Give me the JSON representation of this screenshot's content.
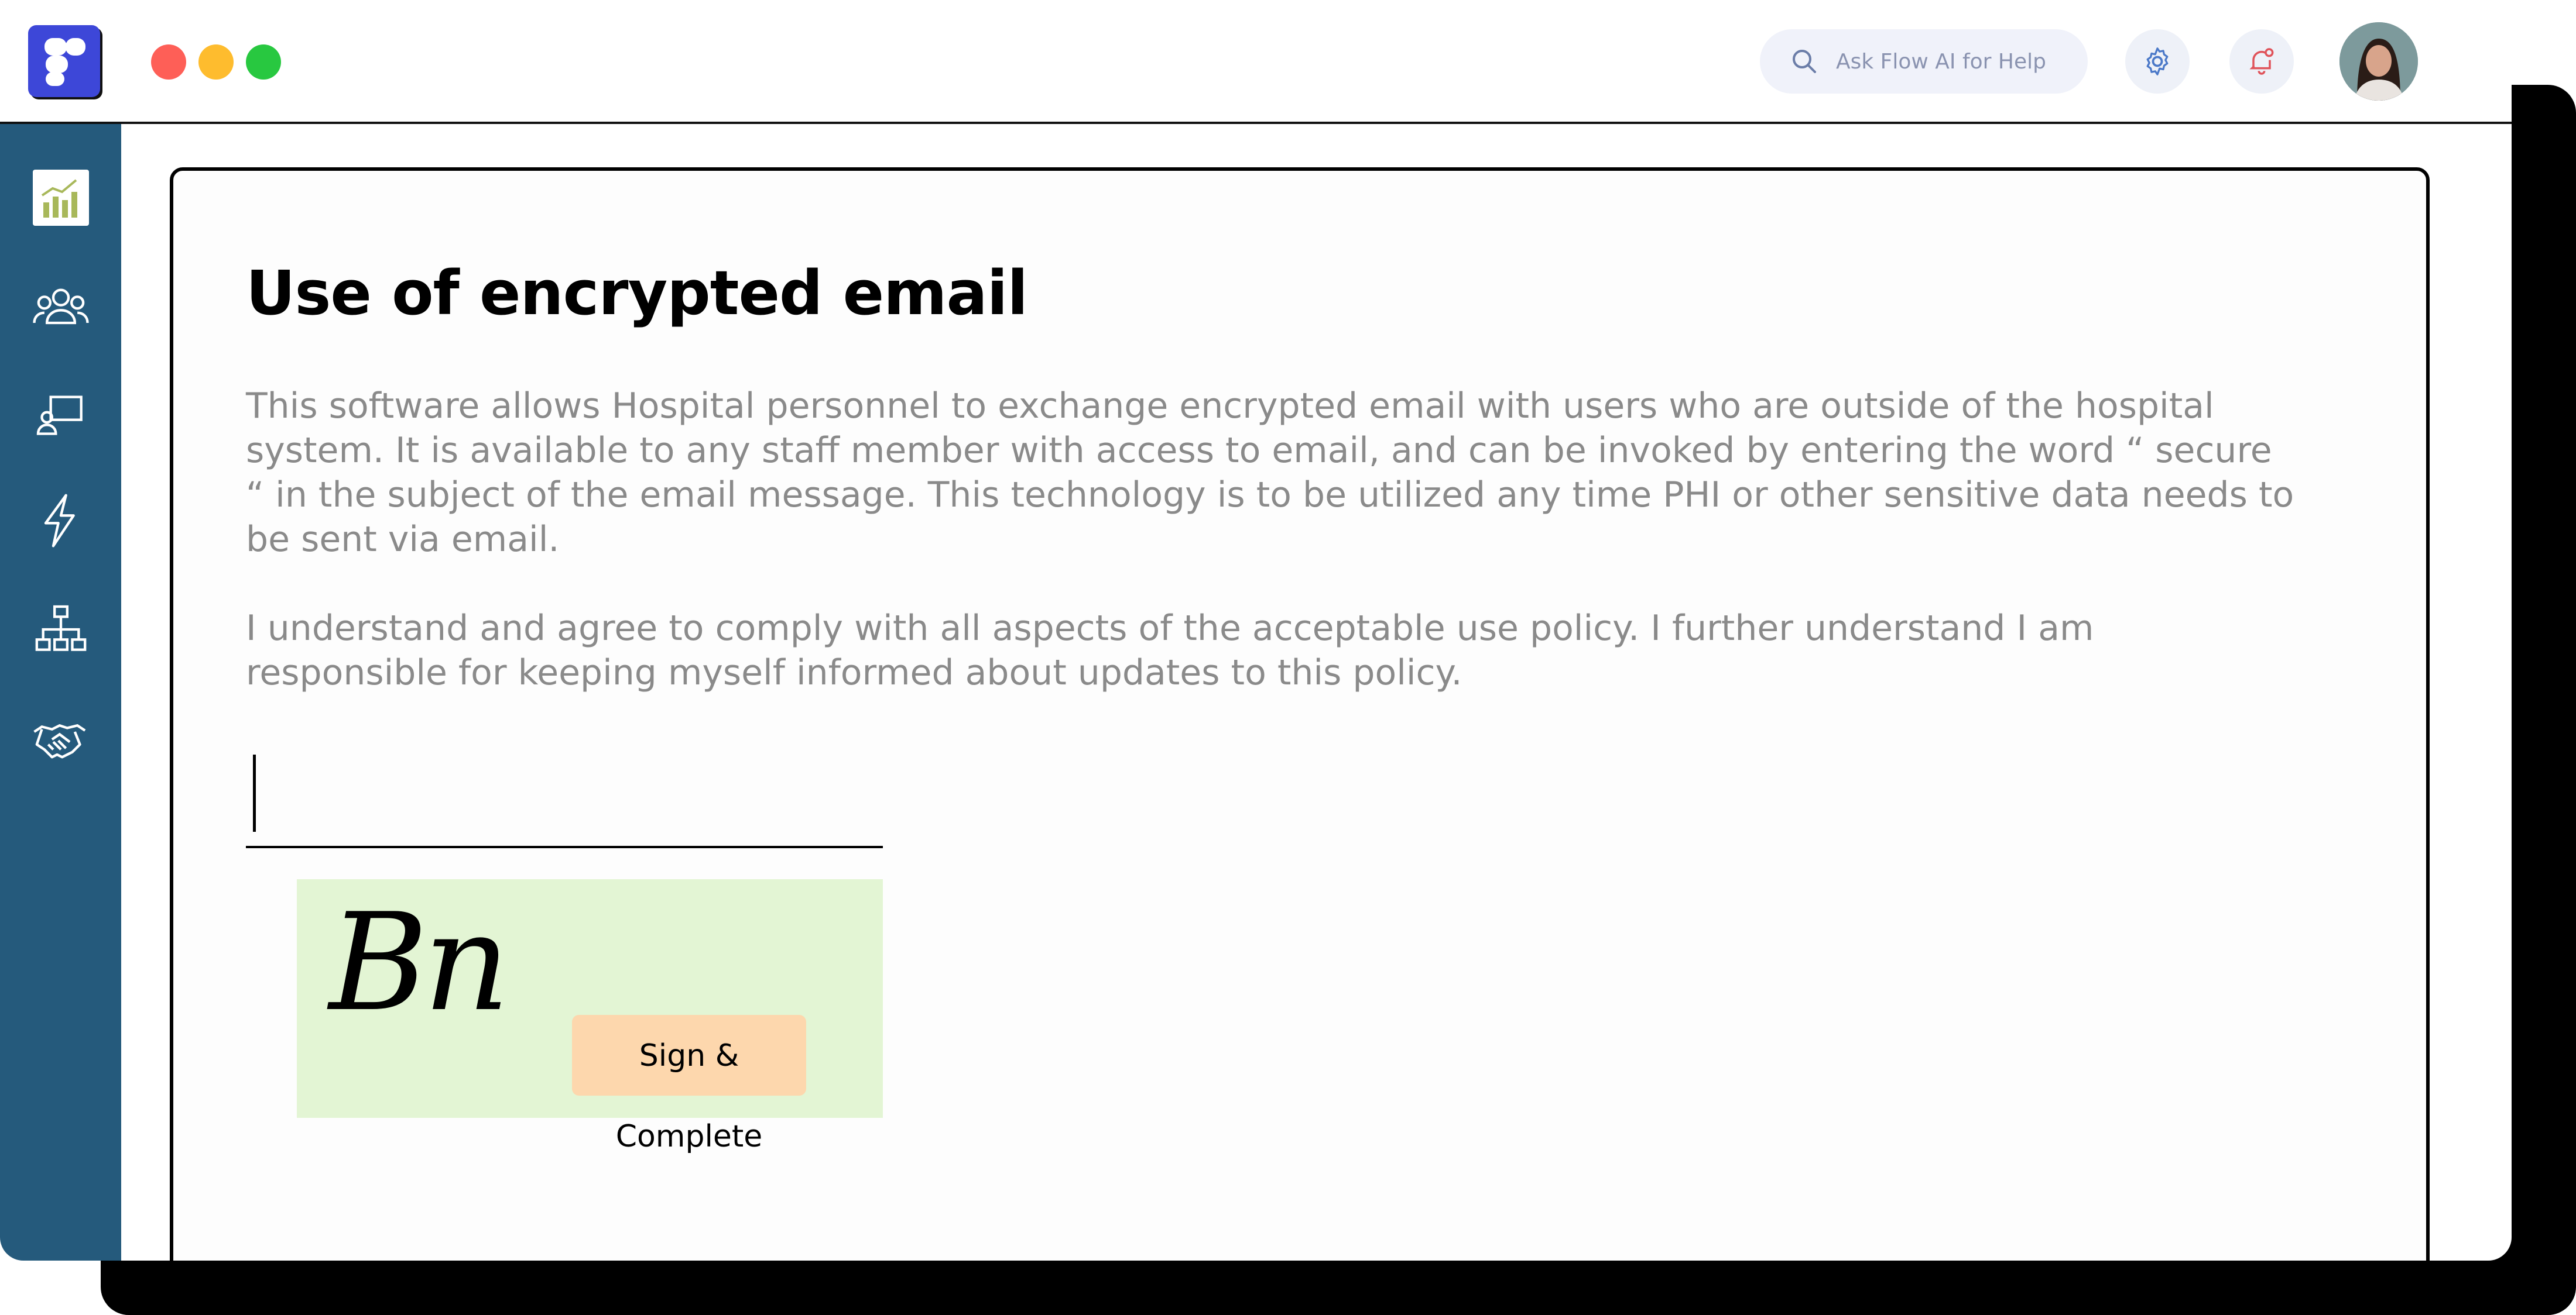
{
  "app": {
    "logo_icon": "app-logo-icon",
    "window_controls": [
      {
        "name": "close",
        "color": "#fe5f57"
      },
      {
        "name": "minimize",
        "color": "#febc2e"
      },
      {
        "name": "maximize",
        "color": "#28c840"
      }
    ]
  },
  "header": {
    "search_placeholder": "Ask Flow AI for Help",
    "settings_icon": "gear-icon",
    "notifications_icon": "bell-icon",
    "avatar": "user-avatar"
  },
  "sidebar": {
    "background": "#255a7c",
    "items": [
      {
        "icon": "analytics-chart-icon",
        "active": true
      },
      {
        "icon": "people-group-icon"
      },
      {
        "icon": "presentation-user-icon"
      },
      {
        "icon": "lightning-icon"
      },
      {
        "icon": "org-chart-icon"
      },
      {
        "icon": "handshake-icon"
      }
    ]
  },
  "document": {
    "title": "Use of encrypted email",
    "paragraph_1": "This software allows Hospital personnel to exchange encrypted email with users who are outside of the hospital system. It is available to any staff member with access to email, and can be invoked by entering the word “ secure “ in the subject of the email message. This technology is to be utilized any time PHI or other sensitive data needs to be sent via email.",
    "paragraph_2": "I understand and agree to comply with all aspects of the acceptable use policy. I further understand I am responsible for keeping myself informed about updates to this policy.",
    "signature_field_value": "",
    "signature_text": "Bn",
    "signature_bg": "#e3f5d4",
    "sign_button_label": "Sign & Complete",
    "sign_button_color": "#fdd7ad"
  }
}
